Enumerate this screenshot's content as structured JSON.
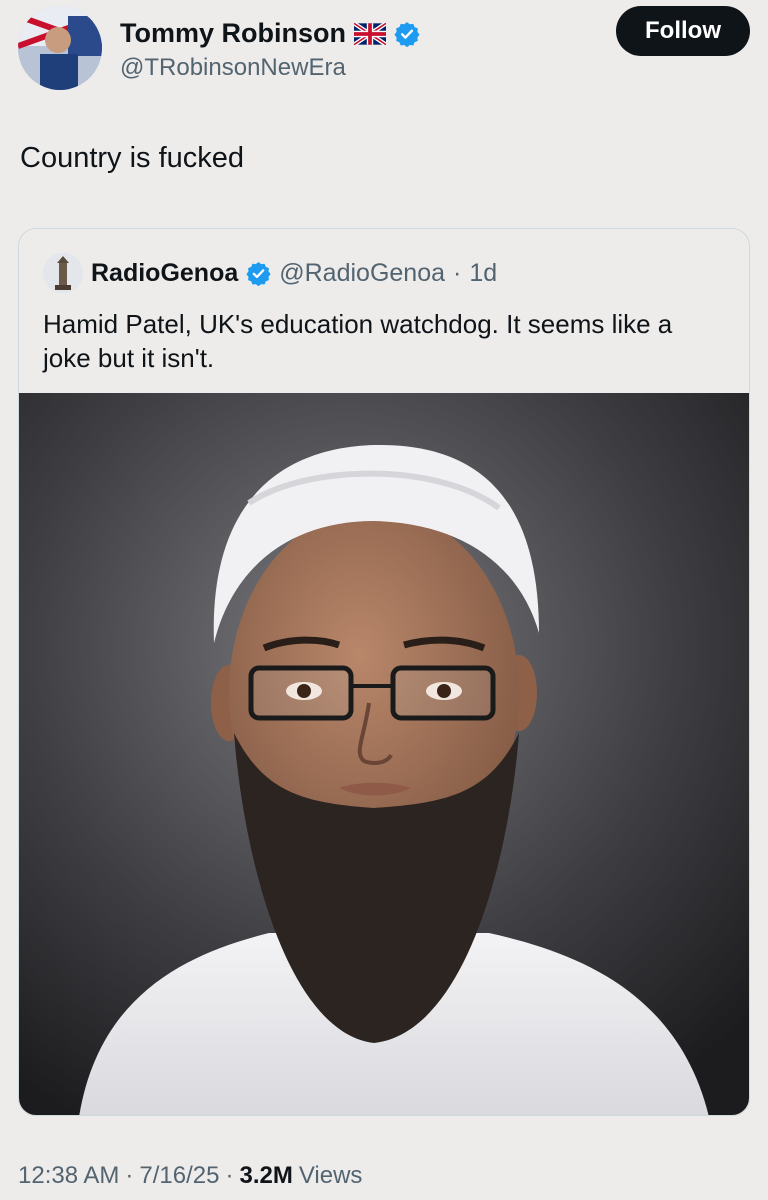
{
  "author": {
    "display_name": "Tommy Robinson",
    "handle": "@TRobinsonNewEra",
    "flag_icon": "uk-flag-icon",
    "verified_icon": "verified-badge-icon"
  },
  "follow_label": "Follow",
  "post": {
    "text": "Country is fucked"
  },
  "quote": {
    "display_name": "RadioGenoa",
    "handle": "@RadioGenoa",
    "separator": "·",
    "time": "1d",
    "text": "Hamid Patel, UK's education watchdog. It seems like a joke but it isn't."
  },
  "meta": {
    "time": "12:38 AM",
    "date": "7/16/25",
    "sep1": "·",
    "sep2": "·",
    "views_count": "3.2M",
    "views_label": "Views"
  },
  "colors": {
    "background": "#eeeceb",
    "verified_blue": "#1d9bf0",
    "button_bg": "#0f1419",
    "secondary_text": "#536471"
  }
}
